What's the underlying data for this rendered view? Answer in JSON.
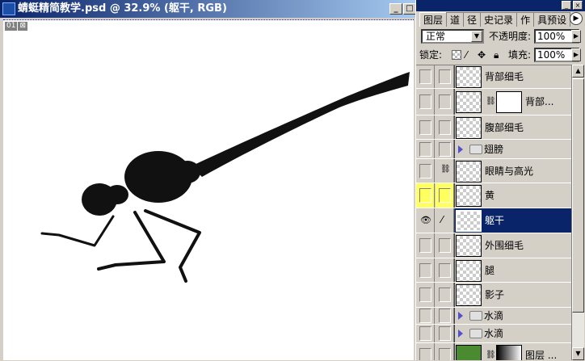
{
  "document": {
    "title": "蜻蜓精简教学.psd @ 32.9% (躯干, RGB)",
    "tag_left": "01",
    "tag_right": "⊠",
    "minimize": "_",
    "maximize": "□"
  },
  "palette": {
    "close": "×",
    "minimize": "_",
    "tabs": [
      {
        "label": "图层"
      },
      {
        "label": "道"
      },
      {
        "label": "径"
      },
      {
        "label": "史记录"
      },
      {
        "label": "作"
      },
      {
        "label": "具预设"
      }
    ],
    "menu_icon": "▶",
    "blend_mode": "正常",
    "opacity_label": "不透明度:",
    "opacity": "100%",
    "lock_label": "锁定:",
    "fill_label": "填充:",
    "fill": "100%",
    "lock_icons": [
      "transparency-lock",
      "brush-lock",
      "move-lock",
      "full-lock"
    ],
    "layers": [
      {
        "name": "背部细毛",
        "type": "layer"
      },
      {
        "name": "背部...",
        "type": "masked"
      },
      {
        "name": "腹部细毛",
        "type": "layer"
      },
      {
        "name": "翅膀",
        "type": "group"
      },
      {
        "name": "眼睛与高光",
        "type": "layer",
        "linked": true
      },
      {
        "name": "黄",
        "type": "layer",
        "color": "#ffff60"
      },
      {
        "name": "躯干",
        "type": "layer",
        "visible": true,
        "selected": true
      },
      {
        "name": "外围细毛",
        "type": "layer"
      },
      {
        "name": "腿",
        "type": "layer"
      },
      {
        "name": "影子",
        "type": "layer"
      },
      {
        "name": "水滴",
        "type": "group"
      },
      {
        "name": "水滴",
        "type": "group"
      },
      {
        "name": "图层 ...",
        "type": "masked"
      }
    ]
  },
  "colors": {
    "title": "#0a246a",
    "selected": "#0a246a",
    "label_yellow": "#ffff60"
  }
}
